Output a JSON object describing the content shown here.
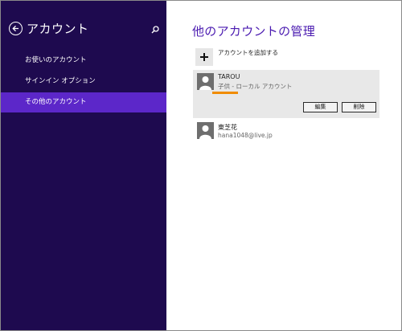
{
  "nav": {
    "title": "アカウント",
    "items": [
      {
        "label": "お使いのアカウント"
      },
      {
        "label": "サインイン オプション"
      },
      {
        "label": "その他のアカウント"
      }
    ],
    "selected_index": 2,
    "background_color": "#1e0a4f",
    "selected_color": "#5c27c9"
  },
  "main": {
    "title": "他のアカウントの管理",
    "add_account_label": "アカウントを追加する",
    "accounts": [
      {
        "name": "TAROU",
        "subtitle": "子供 - ローカル アカウント",
        "edit_label": "編集",
        "delete_label": "削除"
      },
      {
        "name": "東芝花",
        "subtitle": "hana1048@live.jp"
      }
    ],
    "accent_color": "#4a1ab0",
    "highlight_color": "#f08c00"
  }
}
